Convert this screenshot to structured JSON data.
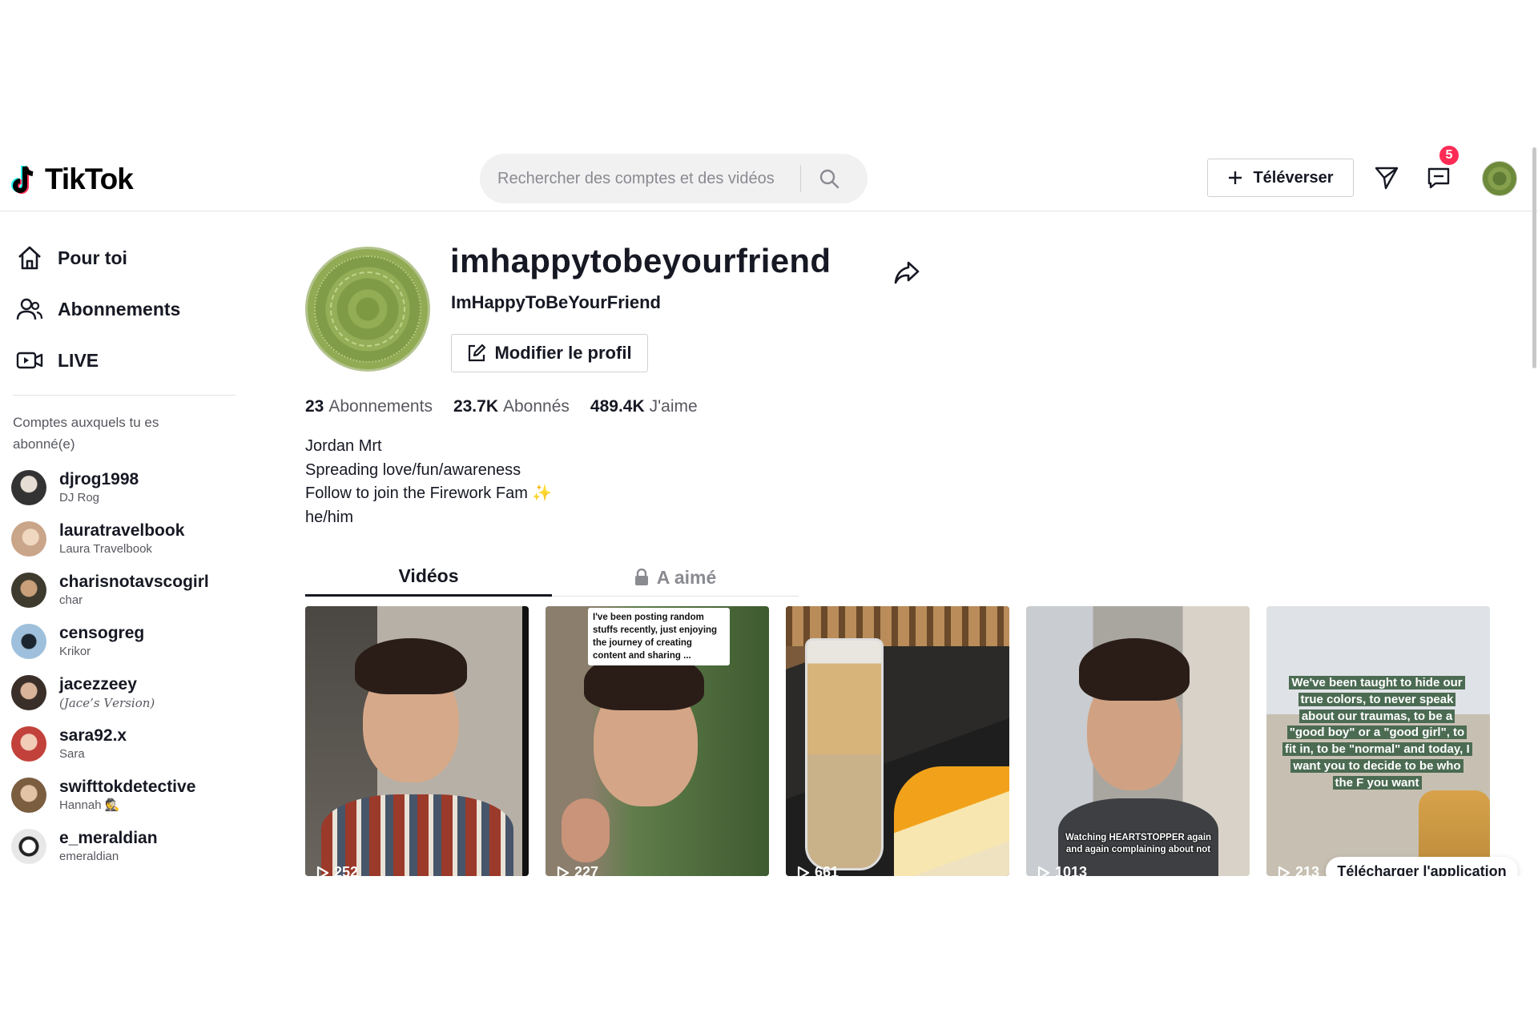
{
  "header": {
    "logo_text": "TikTok",
    "search_placeholder": "Rechercher des comptes et des vidéos",
    "upload_label": "Téléverser",
    "inbox_badge": "5",
    "icons": [
      "search-icon",
      "plus-icon",
      "send-icon",
      "inbox-icon"
    ]
  },
  "sidebar": {
    "nav": [
      {
        "label": "Pour toi",
        "icon": "home-icon"
      },
      {
        "label": "Abonnements",
        "icon": "users-icon"
      },
      {
        "label": "LIVE",
        "icon": "live-camera-icon"
      }
    ],
    "heading": "Comptes auxquels tu es abonné(e)",
    "accounts": [
      {
        "username": "djrog1998",
        "name": "DJ Rog",
        "color": "#6b6b6b"
      },
      {
        "username": "lauratravelbook",
        "name": "Laura Travelbook",
        "color": "#c9a58a"
      },
      {
        "username": "charisnotavscogirl",
        "name": "char",
        "color": "#5a4a3a"
      },
      {
        "username": "censogreg",
        "name": "Krikor",
        "color": "#3d5a80"
      },
      {
        "username": "jacezzeey",
        "name": "(𝐽𝑎𝑐𝑒’𝑠 𝑉𝑒𝑟𝑠𝑖𝑜𝑛)",
        "color": "#4a3a30"
      },
      {
        "username": "sara92.x",
        "name": "Sara",
        "color": "#c2413a"
      },
      {
        "username": "swifttokdetective",
        "name": "Hannah 🕵️",
        "color": "#8a6a4a"
      },
      {
        "username": "e_meraldian",
        "name": "emeraldian",
        "color": "#d8d8d8"
      }
    ]
  },
  "profile": {
    "username": "imhappytobeyourfriend",
    "display_name": "ImHappyToBeYourFriend",
    "edit_label": "Modifier le profil",
    "stats": [
      {
        "value": "23",
        "label": "Abonnements"
      },
      {
        "value": "23.7K",
        "label": "Abonnés"
      },
      {
        "value": "489.4K",
        "label": "J'aime"
      }
    ],
    "bio": [
      "Jordan Mrt",
      "Spreading love/fun/awareness",
      "Follow to join the Firework Fam ✨",
      "he/him"
    ]
  },
  "tabs": {
    "videos": "Vidéos",
    "liked": "A aimé"
  },
  "videos": [
    {
      "views": "252",
      "caption": ""
    },
    {
      "views": "227",
      "caption": "I've been posting random stuffs recently, just enjoying the journey of creating content and sharing ..."
    },
    {
      "views": "661",
      "caption": ""
    },
    {
      "views": "1013",
      "caption": "Watching HEARTSTOPPER again and again complaining about not"
    },
    {
      "views": "213",
      "caption": "We've been taught to hide our true colors, to never speak about our traumas, to be a \"good boy\" or a \"good girl\", to fit in, to be \"normal\" and today, I want you to decide to be who the F you want"
    }
  ],
  "download_app": "Télécharger l'application",
  "colors": {
    "accent": "#fe2c55",
    "text": "#161823",
    "muted": "#57585f"
  }
}
